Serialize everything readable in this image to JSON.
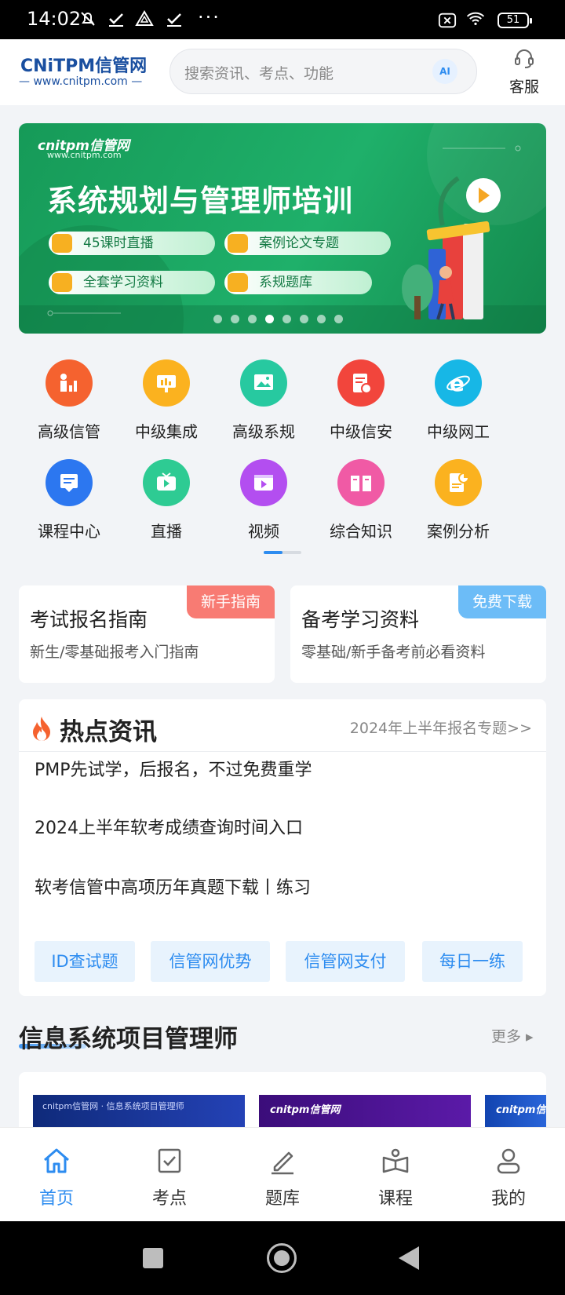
{
  "status_bar": {
    "time": "14:02",
    "dots": "···",
    "battery": "51"
  },
  "header": {
    "logo_main": "CNiTPM信管网",
    "logo_sub": "— www.cnitpm.com —",
    "search_placeholder": "搜索资讯、考点、功能",
    "ai_label": "AI",
    "service_label": "客服"
  },
  "banner": {
    "brand": "cnitpm信管网",
    "url": "www.cnitpm.com",
    "title": "系统规划与管理师培训",
    "pills": [
      "45课时直播",
      "案例论文专题",
      "全套学习资料",
      "系规题库"
    ],
    "page_count": 8,
    "active_index": 3
  },
  "categories": [
    {
      "label": "高级信管",
      "icon": "chart-person-icon",
      "color": "#f5622f"
    },
    {
      "label": "中级集成",
      "icon": "presentation-icon",
      "color": "#fbb21f"
    },
    {
      "label": "高级系规",
      "icon": "image-board-icon",
      "color": "#27c9a0"
    },
    {
      "label": "中级信安",
      "icon": "secure-doc-icon",
      "color": "#f2453c"
    },
    {
      "label": "中级网工",
      "icon": "browser-e-icon",
      "color": "#17b7e6"
    },
    {
      "label": "课程中心",
      "icon": "book-screen-icon",
      "color": "#2c77f0"
    },
    {
      "label": "直播",
      "icon": "tv-play-icon",
      "color": "#2ecb93"
    },
    {
      "label": "视频",
      "icon": "video-play-icon",
      "color": "#b34ef0"
    },
    {
      "label": "综合知识",
      "icon": "open-book-icon",
      "color": "#f05aa5"
    },
    {
      "label": "案例分析",
      "icon": "report-chart-icon",
      "color": "#fbb21f"
    }
  ],
  "guide_cards": [
    {
      "title": "考试报名指南",
      "subtitle": "新生/零基础报考入门指南",
      "badge": "新手指南",
      "badge_color": "#f87b73"
    },
    {
      "title": "备考学习资料",
      "subtitle": "零基础/新手备考前必看资料",
      "badge": "免费下载",
      "badge_color": "#6cbcf7"
    }
  ],
  "news": {
    "title": "热点资讯",
    "link": "2024年上半年报名专题>>",
    "items": [
      "PMP先试学，后报名，不过免费重学",
      "2024上半年软考成绩查询时间入口",
      "软考信管中高项历年真题下载丨练习"
    ],
    "quick_buttons": [
      "ID查试题",
      "信管网优势",
      "信管网支付",
      "每日一练"
    ]
  },
  "section": {
    "title": "信息系统项目管理师",
    "more": "更多 ▸",
    "thumbnails": [
      {
        "text": "cnitpm信管网 · 信息系统项目管理师"
      },
      {
        "text": "cnitpm信管网"
      },
      {
        "text": "cnitpm信管网"
      }
    ]
  },
  "bottom_nav": [
    {
      "label": "首页",
      "icon": "home-icon",
      "active": true
    },
    {
      "label": "考点",
      "icon": "checklist-icon",
      "active": false
    },
    {
      "label": "题库",
      "icon": "pen-icon",
      "active": false
    },
    {
      "label": "课程",
      "icon": "course-reader-icon",
      "active": false
    },
    {
      "label": "我的",
      "icon": "user-icon",
      "active": false
    }
  ]
}
